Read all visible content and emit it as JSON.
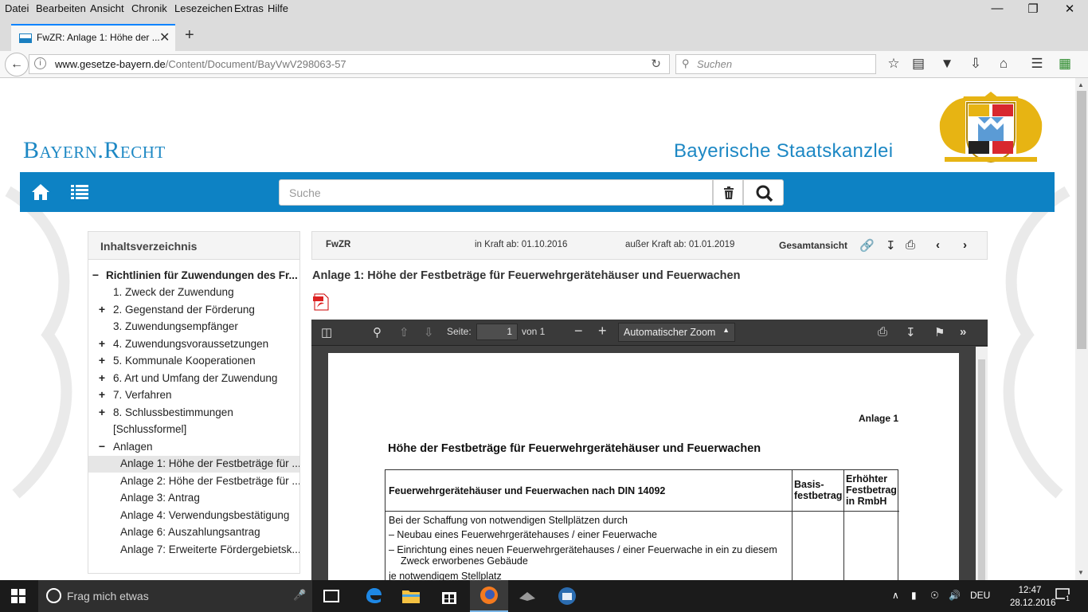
{
  "menu": [
    "Datei",
    "Bearbeiten",
    "Ansicht",
    "Chronik",
    "Lesezeichen",
    "Extras",
    "Hilfe"
  ],
  "window_controls": [
    "—",
    "❐",
    "✕"
  ],
  "tab": {
    "title": "FwZR: Anlage 1: Höhe der ...",
    "close": "✕",
    "new": "+"
  },
  "url": {
    "host": "www.gesetze-bayern.de",
    "path": "/Content/Document/BayVwV298063-57"
  },
  "browser_search": {
    "placeholder": "Suchen"
  },
  "site": {
    "logo_main": "Bayern.Recht",
    "org": "Bayerische Staatskanzlei",
    "search_placeholder": "Suche"
  },
  "toc": {
    "header": "Inhaltsverzeichnis",
    "items": [
      {
        "marker": "−",
        "label": "Richtlinien für Zuwendungen des Fr..."
      },
      {
        "marker": "",
        "label": "1. Zweck der Zuwendung"
      },
      {
        "marker": "+",
        "label": "2. Gegenstand der Förderung"
      },
      {
        "marker": "",
        "label": "3. Zuwendungsempfänger"
      },
      {
        "marker": "+",
        "label": "4. Zuwendungsvoraussetzungen"
      },
      {
        "marker": "+",
        "label": "5. Kommunale Kooperationen"
      },
      {
        "marker": "+",
        "label": "6. Art und Umfang der Zuwendung"
      },
      {
        "marker": "+",
        "label": "7. Verfahren"
      },
      {
        "marker": "+",
        "label": "8. Schlussbestimmungen"
      },
      {
        "marker": "",
        "label": "[Schlussformel]"
      },
      {
        "marker": "−",
        "label": "Anlagen"
      },
      {
        "marker": "",
        "label": "Anlage 1: Höhe der Festbeträge für ..."
      },
      {
        "marker": "",
        "label": "Anlage 2: Höhe der Festbeträge für ..."
      },
      {
        "marker": "",
        "label": "Anlage 3: Antrag"
      },
      {
        "marker": "",
        "label": "Anlage 4: Verwendungsbestätigung"
      },
      {
        "marker": "",
        "label": "Anlage 6: Auszahlungsantrag"
      },
      {
        "marker": "",
        "label": "Anlage 7: Erweiterte Fördergebietsk..."
      }
    ]
  },
  "doc": {
    "abbr": "FwZR",
    "in_kraft": "in Kraft ab: 01.10.2016",
    "ausser_kraft": "außer Kraft ab: 01.01.2019",
    "gesamt": "Gesamtansicht",
    "title": "Anlage 1: Höhe der Festbeträge für Feuerwehrgerätehäuser und Feuerwachen"
  },
  "viewer": {
    "page_label": "Seite:",
    "page_value": "1",
    "page_total": "von 1",
    "zoom": "Automatischer Zoom"
  },
  "pdf": {
    "anlage": "Anlage 1",
    "title": "Höhe der Festbeträge für Feuerwehrgerätehäuser und Feuerwachen",
    "col1": "Feuerwehrgerätehäuser und Feuerwachen nach DIN 14092",
    "col2_l1": "Basis-",
    "col2_l2": "festbetrag",
    "col3_l1": "Erhöhter",
    "col3_l2": "Festbetrag",
    "col3_l3": "in RmbH",
    "row1_l1": "Bei der Schaffung von notwendigen Stellplätzen durch",
    "row1_l2": "–  Neubau eines Feuerwehrgerätehauses / einer Feuerwache",
    "row1_l3": "–  Einrichtung eines neuen Feuerwehrgerätehauses / einer Feuerwache in ein zu diesem",
    "row1_l4": "Zweck erworbenes Gebäude",
    "row1_l5": "je notwendigem Stellplatz"
  },
  "taskbar": {
    "search": "Frag mich etwas",
    "lang": "DEU",
    "time": "12:47",
    "date": "28.12.2016",
    "notif": "1"
  }
}
